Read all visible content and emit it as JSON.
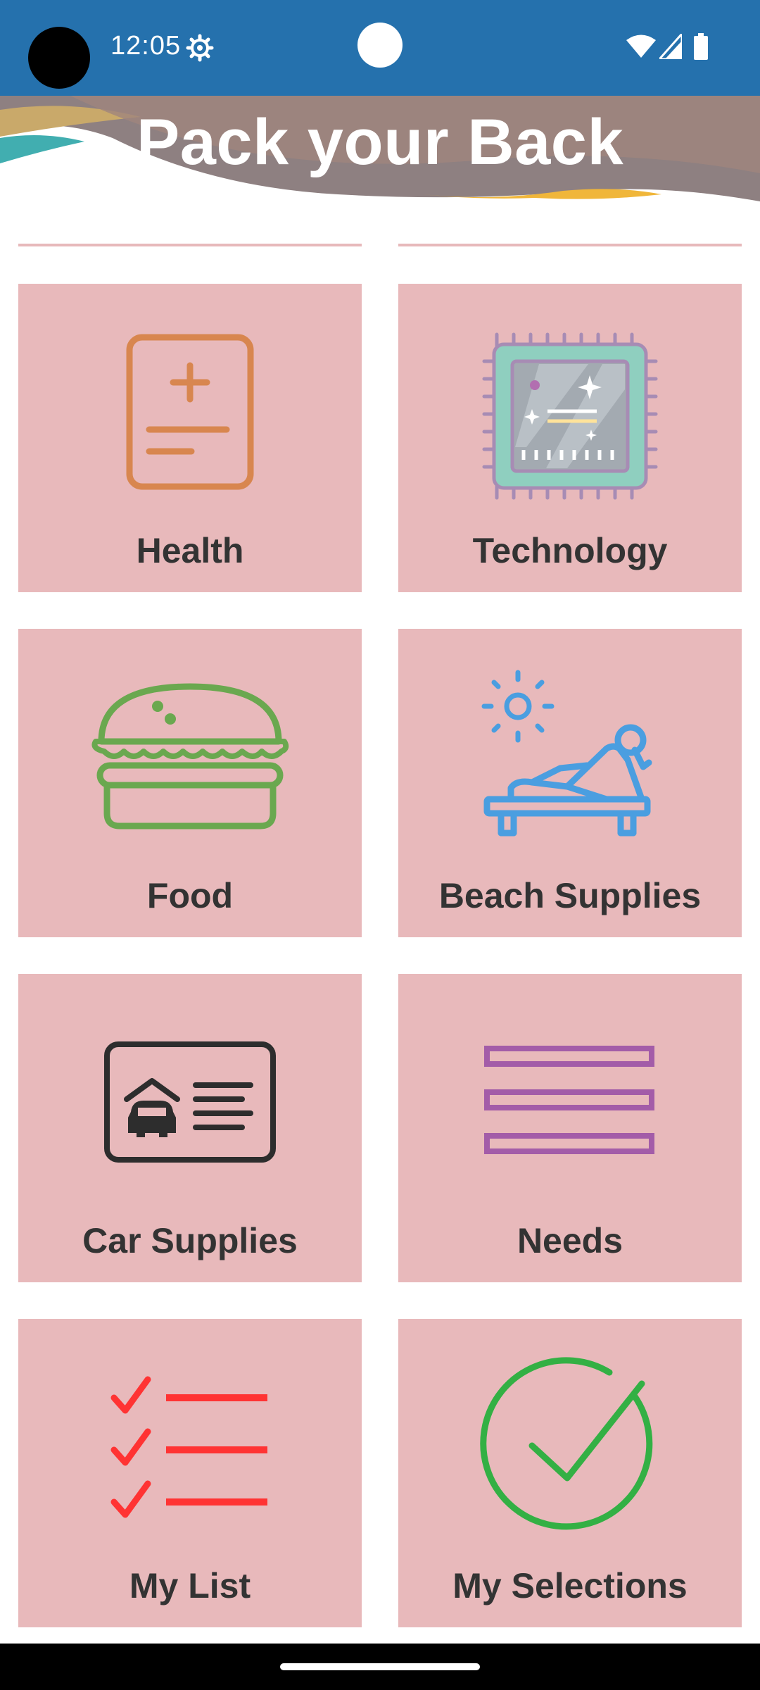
{
  "status_bar": {
    "time": "12:05",
    "icons": [
      "settings-gear-icon",
      "wifi-icon",
      "cellular-signal-icon",
      "battery-icon"
    ]
  },
  "header": {
    "title": "Pack your Back"
  },
  "categories": [
    {
      "label": "Health",
      "icon": "health-document-icon"
    },
    {
      "label": "Technology",
      "icon": "microchip-icon"
    },
    {
      "label": "Food",
      "icon": "burger-icon"
    },
    {
      "label": "Beach Supplies",
      "icon": "sunbathing-icon"
    },
    {
      "label": "Car Supplies",
      "icon": "car-card-icon"
    },
    {
      "label": "Needs",
      "icon": "list-bars-icon"
    },
    {
      "label": "My List",
      "icon": "checklist-icon"
    },
    {
      "label": "My Selections",
      "icon": "check-circle-icon"
    }
  ],
  "colors": {
    "status_bar": "#2571ad",
    "tile_background": "#e8b9bb",
    "label_text": "#333333",
    "health_icon": "#d8864f",
    "food_icon": "#6aa84f",
    "beach_icon": "#4a9ee0",
    "needs_icon": "#a35ca8",
    "my_list_icon": "#ff3333",
    "my_selections_icon": "#33b044"
  }
}
